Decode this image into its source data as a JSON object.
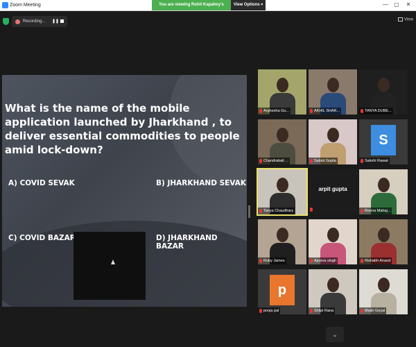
{
  "window": {
    "title": "Zoom Meeting",
    "share_banner": "You are viewing Rohit Kapahey's screen",
    "view_options": "View Options ▾",
    "minimize": "—",
    "maximize": "▢",
    "close": "✕"
  },
  "toolbar": {
    "recording": "Recording...",
    "pause": "❚❚",
    "view": "View"
  },
  "slide": {
    "question": "What is the name of the mobile application launched by Jharkhand , to deliver essential commodities to people amid lock-down?",
    "options": [
      "A) COVID SEVAK",
      "B) JHARKHAND SEVAK",
      "C) COVID BAZAR",
      "D) JHARKHAND BAZAR"
    ]
  },
  "gallery": {
    "participants": [
      {
        "name": "Arghesha Gu...",
        "kind": "video",
        "bg": "#a4a56a",
        "shirt": "#3a3a3a"
      },
      {
        "name": "AKHIL SHAR...",
        "kind": "video",
        "bg": "#8a7a6b",
        "shirt": "#2a4a7a"
      },
      {
        "name": "TANYA DUBE...",
        "kind": "video",
        "bg": "#1f1f1f",
        "shirt": "#222222"
      },
      {
        "name": "Chandrabali ...",
        "kind": "video",
        "bg": "#7b6a58",
        "shirt": "#4d4d3f"
      },
      {
        "name": "Saloni Gupta",
        "kind": "video",
        "bg": "#d8c8c8",
        "shirt": "#c0a070"
      },
      {
        "name": "Sakshi Rawat",
        "kind": "initial",
        "initial": "S",
        "color": "#3d8ee0"
      },
      {
        "name": "Tanya Chaudhary",
        "kind": "video",
        "bg": "#c9c4bb",
        "shirt": "#2d2d2d",
        "active": true
      },
      {
        "name": "arpit gupta",
        "kind": "name"
      },
      {
        "name": "Reena Mahaj...",
        "kind": "video",
        "bg": "#d6cfc0",
        "shirt": "#2e6b3a"
      },
      {
        "name": "Ruby James",
        "kind": "video",
        "bg": "#b3a493",
        "shirt": "#1f1f1f"
      },
      {
        "name": "Apurva singh",
        "kind": "video",
        "bg": "#e2d6cc",
        "shirt": "#c8557a"
      },
      {
        "name": "Rishabh Anand",
        "kind": "video",
        "bg": "#8c7b62",
        "shirt": "#9a3030"
      },
      {
        "name": "pooja pal",
        "kind": "initial",
        "initial": "p",
        "color": "#e8762d"
      },
      {
        "name": "Shilpi Rana",
        "kind": "video",
        "bg": "#cfc8bf",
        "shirt": "#3a3a3a"
      },
      {
        "name": "Maitri Goyal",
        "kind": "video",
        "bg": "#dedbd4",
        "shirt": "#b8b0a0"
      }
    ]
  },
  "controls": {
    "scroll_down": "⌄"
  }
}
